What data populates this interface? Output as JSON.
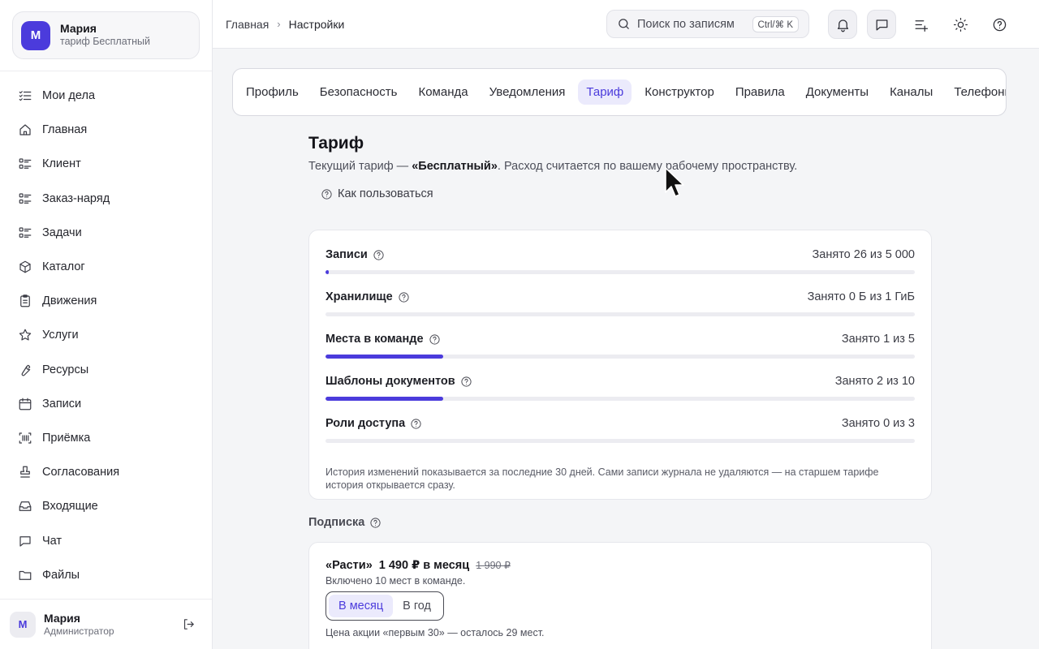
{
  "workspace": {
    "avatar": "М",
    "name": "Мария",
    "plan": "тариф Бесплатный"
  },
  "sidebar": {
    "items": [
      {
        "label": "Мои дела",
        "icon": "checklist-icon"
      },
      {
        "label": "Главная",
        "icon": "home-icon"
      },
      {
        "label": "Клиент",
        "icon": "list-icon"
      },
      {
        "label": "Заказ-наряд",
        "icon": "list-icon"
      },
      {
        "label": "Задачи",
        "icon": "list-icon"
      },
      {
        "label": "Каталог",
        "icon": "box-icon"
      },
      {
        "label": "Движения",
        "icon": "clipboard-icon"
      },
      {
        "label": "Услуги",
        "icon": "star-icon"
      },
      {
        "label": "Ресурсы",
        "icon": "wrench-icon"
      },
      {
        "label": "Записи",
        "icon": "calendar-icon"
      },
      {
        "label": "Приёмка",
        "icon": "scan-icon"
      },
      {
        "label": "Согласования",
        "icon": "stamp-icon"
      },
      {
        "label": "Входящие",
        "icon": "inbox-icon"
      },
      {
        "label": "Чат",
        "icon": "chat-icon"
      },
      {
        "label": "Файлы",
        "icon": "folder-icon"
      }
    ]
  },
  "user": {
    "avatar": "М",
    "name": "Мария",
    "role": "Администратор"
  },
  "breadcrumb": {
    "home": "Главная",
    "separator": "›",
    "current": "Настройки"
  },
  "search": {
    "placeholder": "Поиск по записям",
    "shortcut": "Ctrl/⌘ K"
  },
  "tabs": [
    {
      "label": "Профиль",
      "active": false
    },
    {
      "label": "Безопасность",
      "active": false
    },
    {
      "label": "Команда",
      "active": false
    },
    {
      "label": "Уведомления",
      "active": false
    },
    {
      "label": "Тариф",
      "active": true
    },
    {
      "label": "Конструктор",
      "active": false
    },
    {
      "label": "Правила",
      "active": false
    },
    {
      "label": "Документы",
      "active": false
    },
    {
      "label": "Каналы",
      "active": false
    },
    {
      "label": "Телефония",
      "active": false
    }
  ],
  "page": {
    "title": "Тариф",
    "subtitle_prefix": "Текущий тариф — ",
    "subtitle_plan": "«Бесплатный»",
    "subtitle_suffix": ". Расход считается по вашему рабочему пространству.",
    "howto": "Как пользоваться"
  },
  "usage": {
    "rows": [
      {
        "label": "Записи",
        "value": "Занято 26 из 5 000",
        "fraction": 0.0052
      },
      {
        "label": "Хранилище",
        "value": "Занято 0 Б из 1 ГиБ",
        "fraction": 0
      },
      {
        "label": "Места в команде",
        "value": "Занято 1 из 5",
        "fraction": 0.2
      },
      {
        "label": "Шаблоны документов",
        "value": "Занято 2 из 10",
        "fraction": 0.2
      },
      {
        "label": "Роли доступа",
        "value": "Занято 0 из 3",
        "fraction": 0
      }
    ],
    "note": "История изменений показывается за последние 30 дней. Сами записи журнала не удаляются — на старшем тарифе история открывается сразу."
  },
  "subscription": {
    "title": "Подписка",
    "plan_name": "«Расти»",
    "price": "1 490 ₽ в месяц",
    "old_price": "1 990 ₽",
    "included": "Включено 10 мест в команде.",
    "period_month": "В месяц",
    "period_year": "В год",
    "promo": "Цена акции «первым 30» — осталось 29 мест."
  },
  "colors": {
    "accent": "#4b3bdc",
    "accent_bg": "#ebeafc"
  }
}
